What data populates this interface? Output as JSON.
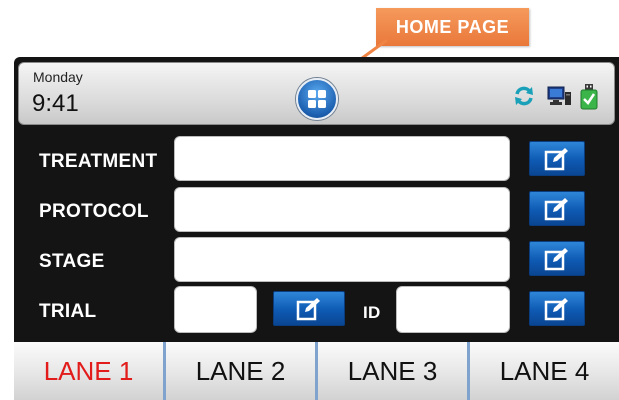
{
  "callout": {
    "label": "HOME PAGE"
  },
  "status": {
    "day": "Monday",
    "time": "9:41",
    "icons": [
      "home-icon",
      "sync-icon",
      "network-icon",
      "usb-icon"
    ],
    "colors": {
      "home_button": "#1c5fb0",
      "sync": "#1aa0b8",
      "usb": "#3bb54a"
    }
  },
  "form": {
    "treatment_label": "TREATMENT",
    "protocol_label": "PROTOCOL",
    "stage_label": "STAGE",
    "trial_label": "TRIAL",
    "id_label": "ID",
    "treatment_value": "",
    "protocol_value": "",
    "stage_value": "",
    "trial_value": "",
    "id_value": ""
  },
  "lanes": [
    {
      "label": "LANE 1",
      "active": true
    },
    {
      "label": "LANE 2",
      "active": false
    },
    {
      "label": "LANE 3",
      "active": false
    },
    {
      "label": "LANE 4",
      "active": false
    }
  ],
  "theme": {
    "active_lane_color": "#e21b1b",
    "edit_button_color": "#0e5ab4",
    "callout_color": "#ef8444"
  }
}
